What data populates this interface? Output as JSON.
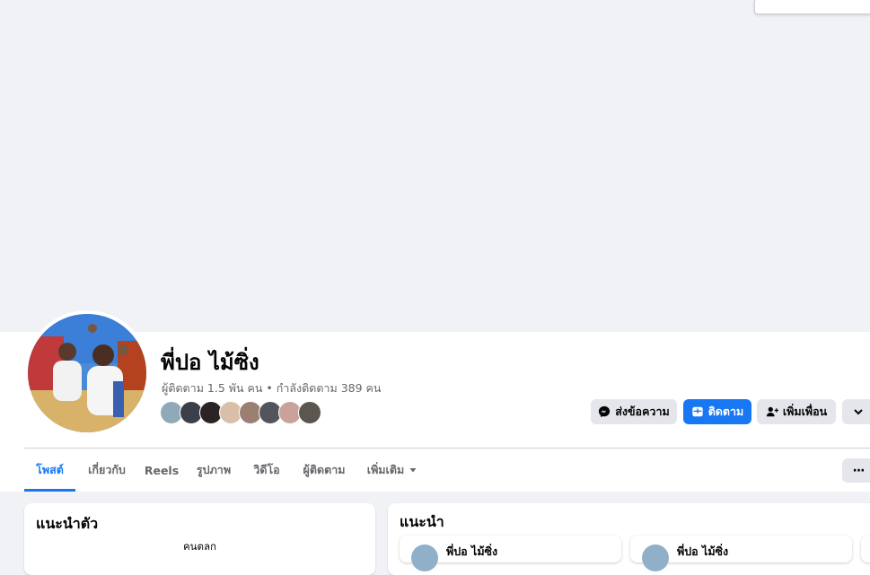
{
  "profile": {
    "name": "พี่ปอ ไม้ซิ่ง",
    "followers_text": "ผู้ติดตาม 1.5 พัน คน",
    "separator": " • ",
    "following_text": "กำลังติดตาม 389 คน"
  },
  "actions": {
    "message_label": "ส่งข้อความ",
    "follow_label": "ติดตาม",
    "add_friend_label": "เพิ่มเพื่อน"
  },
  "tabs": [
    {
      "label": "โพสต์",
      "active": true
    },
    {
      "label": "เกี่ยวกับ"
    },
    {
      "label": "Reels"
    },
    {
      "label": "รูปภาพ"
    },
    {
      "label": "วิดีโอ"
    },
    {
      "label": "ผู้ติดตาม"
    },
    {
      "label": "เพิ่มเติม"
    }
  ],
  "tab_more_button": "···",
  "intro": {
    "title": "แนะนำตัว",
    "bio": "คนตลก"
  },
  "suggestions": {
    "title": "แนะนำ",
    "items": [
      {
        "name": "พี่ปอ ไม้ซิ่ง"
      },
      {
        "name": "พี่ปอ ไม้ซิ่ง"
      }
    ]
  },
  "colors": {
    "accent": "#1877f2",
    "secondary_button": "#e4e6eb",
    "muted_text": "#65676b",
    "page_background": "#f0f2f5"
  },
  "icons": {
    "message": "messenger-icon",
    "follow": "follow-icon",
    "add_friend": "add-friend-icon",
    "more": "chevron-down-icon",
    "tab_more": "caret-down-icon"
  }
}
